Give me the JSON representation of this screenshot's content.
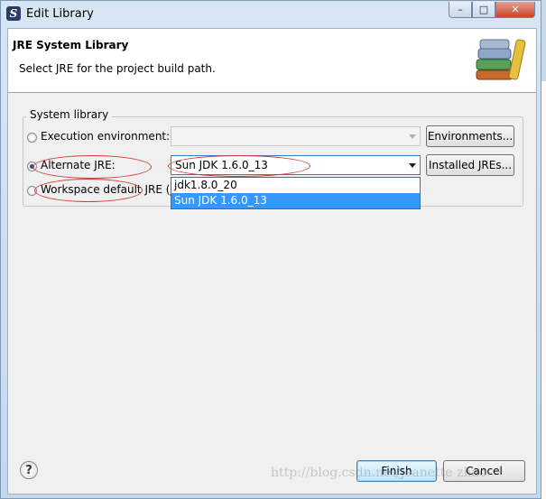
{
  "window": {
    "title": "Edit Library",
    "controls": [
      "minimize",
      "maximize",
      "close"
    ]
  },
  "header": {
    "title": "JRE System Library",
    "description": "Select JRE for the project build path."
  },
  "group": {
    "label": "System library",
    "execution_env": {
      "label": "Execution environment:",
      "value": "",
      "button": "Environments..."
    },
    "alternate": {
      "label": "Alternate JRE:",
      "value": "Sun JDK 1.6.0_13",
      "button": "Installed JREs..."
    },
    "workspace": {
      "label": "Workspace default JRE (j"
    }
  },
  "dropdown": {
    "options": [
      "jdk1.8.0_20",
      "Sun JDK 1.6.0_13"
    ],
    "selected": "Sun JDK 1.6.0_13"
  },
  "footer": {
    "finish": "Finish",
    "cancel": "Cancel"
  },
  "watermark": "http://blog.csdn.net/jeanette zhao",
  "annotation_color": "#d23a3a"
}
